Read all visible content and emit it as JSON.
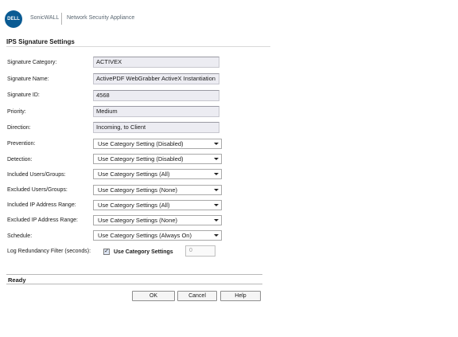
{
  "header": {
    "logo_text": "DELL",
    "brand": "SonicWALL",
    "product": "Network Security Appliance"
  },
  "page": {
    "title": "IPS Signature Settings"
  },
  "fields": {
    "signature_category": {
      "label": "Signature Category:",
      "value": "ACTIVEX"
    },
    "signature_name": {
      "label": "Signature Name:",
      "value": "ActivePDF WebGrabber ActiveX Instantiation"
    },
    "signature_id": {
      "label": "Signature ID:",
      "value": "4568"
    },
    "priority": {
      "label": "Priority:",
      "value": "Medium"
    },
    "direction": {
      "label": "Direction:",
      "value": "Incoming, to Client"
    },
    "prevention": {
      "label": "Prevention:",
      "value": "Use Category Setting (Disabled)"
    },
    "detection": {
      "label": "Detection:",
      "value": "Use Category Setting (Disabled)"
    },
    "included_users": {
      "label": "Included Users/Groups:",
      "value": "Use Category Settings (All)"
    },
    "excluded_users": {
      "label": "Excluded Users/Groups:",
      "value": "Use Category Settings (None)"
    },
    "included_ip": {
      "label": "Included IP Address Range:",
      "value": "Use Category Settings (All)"
    },
    "excluded_ip": {
      "label": "Excluded IP Address Range:",
      "value": "Use Category Settings (None)"
    },
    "schedule": {
      "label": "Schedule:",
      "value": "Use Category Settings (Always On)"
    },
    "log_redundancy": {
      "label": "Log Redundancy Filter (seconds):",
      "checkbox_label": "Use Category Settings",
      "checked": true,
      "check_glyph": "✓",
      "seconds_value": "0"
    }
  },
  "status": {
    "text": "Ready"
  },
  "buttons": {
    "ok": "OK",
    "cancel": "Cancel",
    "help": "Help"
  },
  "colors": {
    "logo_blue": "#0a5b93",
    "readonly_bg": "#ececf2"
  },
  "icons": {
    "dropdown": "chevron-down-icon",
    "logo": "dell-logo-icon",
    "check": "checkmark-icon"
  }
}
